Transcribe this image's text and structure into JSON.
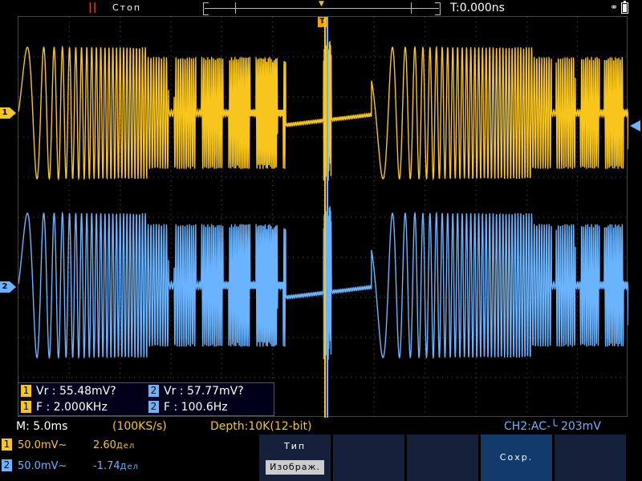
{
  "status": {
    "run_state": "Стоп",
    "time_offset": "T:0.000ns"
  },
  "measurements": [
    {
      "channel": "1",
      "label": "Vr : 55.48mV?"
    },
    {
      "channel": "2",
      "label": "Vr : 57.77mV?"
    },
    {
      "channel": "1",
      "label": "F : 2.000KHz"
    },
    {
      "channel": "2",
      "label": "F : 100.6Hz"
    }
  ],
  "statusline": {
    "timebase": "M: 5.0ms",
    "sample_rate": "(100KS/s)",
    "depth": "Depth:10K(12-bit)",
    "trigger": "CH2:AC-╰ 203mV"
  },
  "channels": [
    {
      "id": "1",
      "volts_div": "50.0mV~",
      "position": "2.60",
      "position_unit": "Дел",
      "color": "#f7c51c"
    },
    {
      "id": "2",
      "volts_div": "50.0mV~",
      "position": "-1.74",
      "position_unit": "Дел",
      "color": "#6ab4ff"
    }
  ],
  "softkeys": [
    {
      "title": "Тип",
      "value": "Изображ."
    },
    {
      "title": "",
      "value": ""
    },
    {
      "title": "",
      "value": ""
    },
    {
      "title": "Сохр.",
      "value": ""
    },
    {
      "title": "",
      "value": ""
    }
  ],
  "markers": {
    "trigger_pos": "T",
    "ch1": "1",
    "ch2": "2"
  },
  "colors": {
    "ch1": "#f7c51c",
    "ch2": "#6ab4ff",
    "trigger": "#f5a500",
    "run_state": "#e23a3a"
  }
}
